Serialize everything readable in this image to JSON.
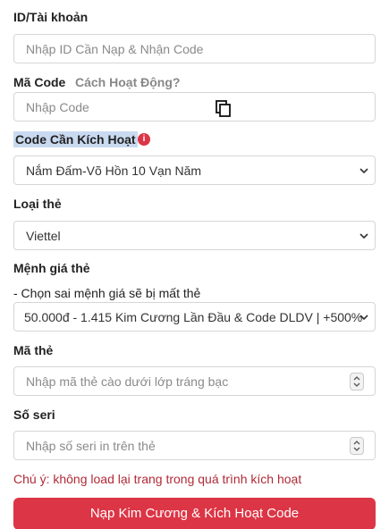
{
  "account": {
    "label": "ID/Tài khoản",
    "placeholder": "Nhập ID Cần Nạp & Nhận Code"
  },
  "code": {
    "label": "Mã Code",
    "help_link": "Cách Hoạt Động?",
    "placeholder": "Nhập Code",
    "copy_icon": "copy-icon"
  },
  "activate": {
    "label": "Code Cần Kích Hoạt",
    "info_icon": "info-icon",
    "selected": "Nắm Đấm-Võ Hồn 10 Vạn Năm"
  },
  "card_type": {
    "label": "Loại thẻ",
    "selected": "Viettel"
  },
  "denomination": {
    "label": "Mệnh giá thẻ",
    "note": "- Chọn sai mệnh giá sẽ bị mất thẻ",
    "selected": "50.000đ - 1.415 Kim Cương Lần Đầu & Code DLDV | +500%"
  },
  "card_code": {
    "label": "Mã thẻ",
    "placeholder": "Nhập mã thẻ cào dưới lớp tráng bạc"
  },
  "serial": {
    "label": "Số seri",
    "placeholder": "Nhập số seri in trên thẻ"
  },
  "warning": "Chú ý: không load lại trang trong quá trình kích hoạt",
  "submit_label": "Nạp Kim Cương & Kích Hoạt Code",
  "colors": {
    "accent": "#dc3545",
    "warning_text": "#b02a37",
    "help_link": "#888888",
    "highlight": "#c9d9f0"
  }
}
